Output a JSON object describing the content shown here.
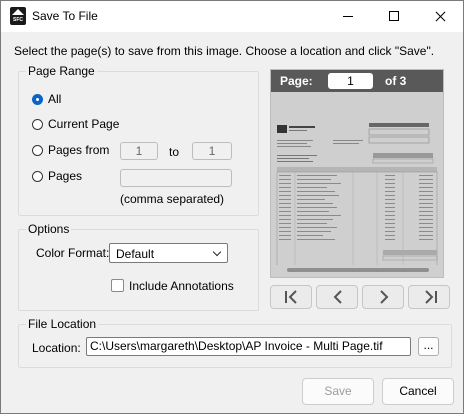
{
  "window": {
    "title": "Save To File",
    "app_icon": "sfc-logo-icon",
    "app_icon_text": "SFC",
    "buttons": [
      "minimize-icon",
      "maximize-icon",
      "close-icon"
    ]
  },
  "instructions": "Select the page(s) to save from this image. Choose a location and click \"Save\".",
  "page_range": {
    "legend": "Page Range",
    "options": [
      {
        "label": "All",
        "checked": true
      },
      {
        "label": "Current Page",
        "checked": false
      },
      {
        "label": "Pages from",
        "checked": false
      },
      {
        "label": "Pages",
        "checked": false
      }
    ],
    "from_value": "1",
    "to_label": "to",
    "to_value": "1",
    "pages_list_value": "",
    "pages_hint": "(comma separated)"
  },
  "options": {
    "legend": "Options",
    "color_format_label": "Color Format:",
    "color_format_value": "Default",
    "include_annotations_label": "Include Annotations",
    "include_annotations_checked": false
  },
  "preview": {
    "page_label": "Page:",
    "page_value": "1",
    "of_label": "of 3",
    "nav_buttons": [
      "first-page-icon",
      "previous-page-icon",
      "next-page-icon",
      "last-page-icon"
    ]
  },
  "file_location": {
    "legend": "File Location",
    "location_label": "Location:",
    "path": "C:\\Users\\margareth\\Desktop\\AP Invoice - Multi Page.tif",
    "browse_label": "..."
  },
  "actions": {
    "save_label": "Save",
    "cancel_label": "Cancel"
  },
  "colors": {
    "accent": "#0a64c8",
    "preview_bar": "#595959",
    "window_bg": "#f0f0f0"
  }
}
